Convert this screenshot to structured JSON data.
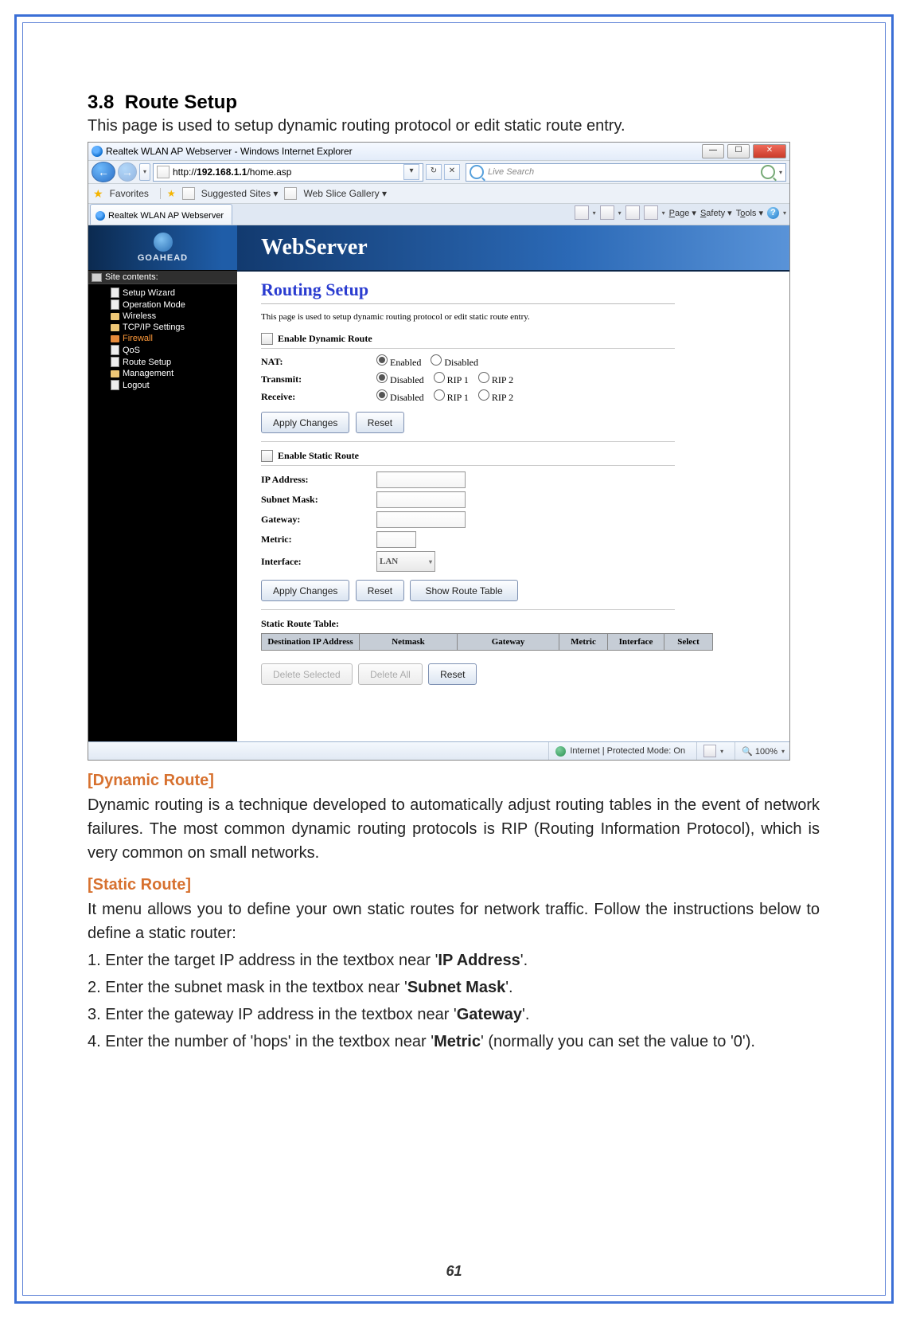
{
  "doc": {
    "section_no": "3.8",
    "section_title": "Route Setup",
    "intro": "This page is used to setup dynamic routing protocol or edit static route entry.",
    "dynamic_head": "[Dynamic Route]",
    "dynamic_text": "Dynamic routing is a technique developed to automatically adjust routing tables in the event of network failures. The most common dynamic routing protocols is RIP (Routing Information Protocol), which is very common on small networks.",
    "static_head": "[Static Route]",
    "static_intro": "It menu allows you to define your own static routes for network traffic. Follow the instructions below to define a static router:",
    "step1_a": "1. Enter the target IP address in the textbox near '",
    "step1_b": "IP Address",
    "step1_c": "'.",
    "step2_a": "2. Enter the subnet mask in the textbox near '",
    "step2_b": "Subnet Mask",
    "step2_c": "'.",
    "step3_a": "3. Enter the gateway IP address in the textbox near '",
    "step3_b": "Gateway",
    "step3_c": "'.",
    "step4_a": "4. Enter the number of 'hops' in the textbox near '",
    "step4_b": "Metric",
    "step4_c": "' (normally you can set the value to '0').",
    "page_no": "61"
  },
  "window": {
    "title": "Realtek WLAN AP Webserver - Windows Internet Explorer",
    "url_prefix": "http://",
    "url_host": "192.168.1.1",
    "url_path": "/home.asp",
    "search_placeholder": "Live Search",
    "fav_label": "Favorites",
    "suggested": "Suggested Sites",
    "slice": "Web Slice Gallery",
    "tab": "Realtek WLAN AP Webserver",
    "cmd_page": "Page",
    "cmd_safety": "Safety",
    "cmd_tools": "Tools",
    "status_mode": "Internet | Protected Mode: On",
    "zoom": "100%"
  },
  "sidebar": {
    "head": "Site contents:",
    "items": [
      "Setup Wizard",
      "Operation Mode",
      "Wireless",
      "TCP/IP Settings",
      "Firewall",
      "QoS",
      "Route Setup",
      "Management",
      "Logout"
    ],
    "active_index": 4,
    "logo": "GOAHEAD"
  },
  "banner": "WebServer",
  "panel": {
    "title": "Routing Setup",
    "desc": "This page is used to setup dynamic routing protocol or edit static route entry.",
    "enable_dynamic": "Enable Dynamic Route",
    "nat_label": "NAT:",
    "nat_opts": [
      "Enabled",
      "Disabled"
    ],
    "nat_sel": 0,
    "transmit_label": "Transmit:",
    "trip_opts": [
      "Disabled",
      "RIP 1",
      "RIP 2"
    ],
    "transmit_sel": 0,
    "receive_label": "Receive:",
    "receive_sel": 0,
    "apply": "Apply Changes",
    "reset": "Reset",
    "enable_static": "Enable Static Route",
    "ip_label": "IP Address:",
    "mask_label": "Subnet Mask:",
    "gw_label": "Gateway:",
    "metric_label": "Metric:",
    "iface_label": "Interface:",
    "iface_value": "LAN",
    "show_table": "Show Route Table",
    "table_label": "Static Route Table:",
    "th": [
      "Destination IP Address",
      "Netmask",
      "Gateway",
      "Metric",
      "Interface",
      "Select"
    ],
    "del_sel": "Delete Selected",
    "del_all": "Delete All"
  }
}
